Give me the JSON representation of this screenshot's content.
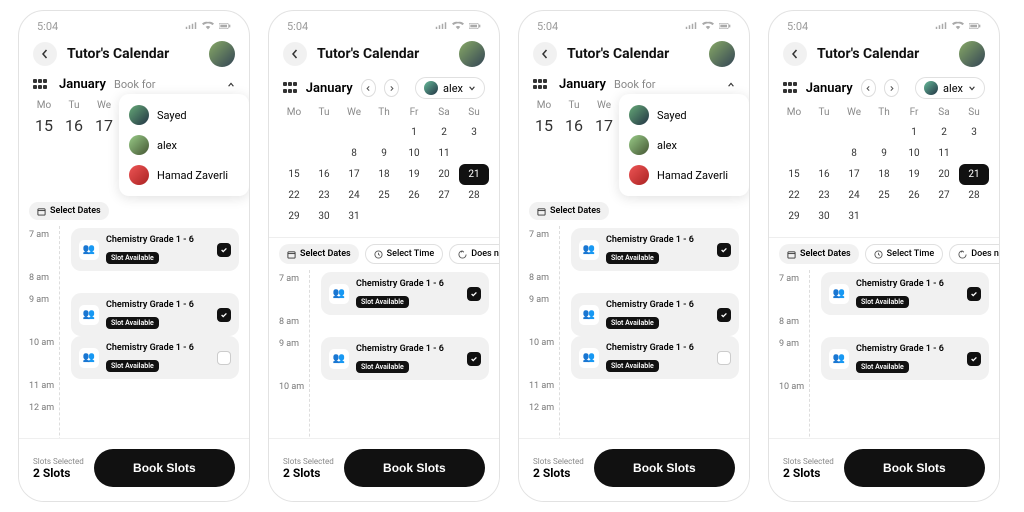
{
  "status": {
    "time": "5:04"
  },
  "header": {
    "title": "Tutor's Calendar"
  },
  "month": {
    "name": "January",
    "book_for": "Book for",
    "selected_person": "alex"
  },
  "weekdays": [
    "Mo",
    "Tu",
    "We",
    "Th",
    "Fr",
    "Sa",
    "Su"
  ],
  "weekdays_short3": [
    "Mo",
    "Tu",
    "We"
  ],
  "cal_rows": [
    [
      "",
      "",
      "",
      "",
      "1",
      "2",
      "3"
    ],
    [
      "",
      "",
      "8",
      "9",
      "10",
      "11",
      ""
    ],
    [
      "15",
      "16",
      "17",
      "18",
      "19",
      "20",
      "21"
    ],
    [
      "22",
      "23",
      "24",
      "25",
      "26",
      "27",
      "28"
    ],
    [
      "29",
      "30",
      "31",
      "",
      "",
      "",
      ""
    ]
  ],
  "cal_row0_short": [
    "15",
    "16",
    "17"
  ],
  "selected_day": "21",
  "pills": {
    "select_dates": "Select Dates",
    "select_time": "Select Time",
    "does_not_repeat": "Does not r"
  },
  "people": [
    {
      "name": "Sayed"
    },
    {
      "name": "alex"
    },
    {
      "name": "Hamad Zaverli"
    }
  ],
  "hours_full": [
    "7 am",
    "8 am",
    "9 am",
    "10 am",
    "11 am",
    "12 am"
  ],
  "hours_v2": [
    "7 am",
    "8 am",
    "9 am",
    "10 am"
  ],
  "slot": {
    "title": "Chemistry Grade 1 - 6",
    "badge": "Slot Available"
  },
  "footer": {
    "label": "Slots Selected",
    "value": "2 Slots",
    "button": "Book Slots"
  }
}
